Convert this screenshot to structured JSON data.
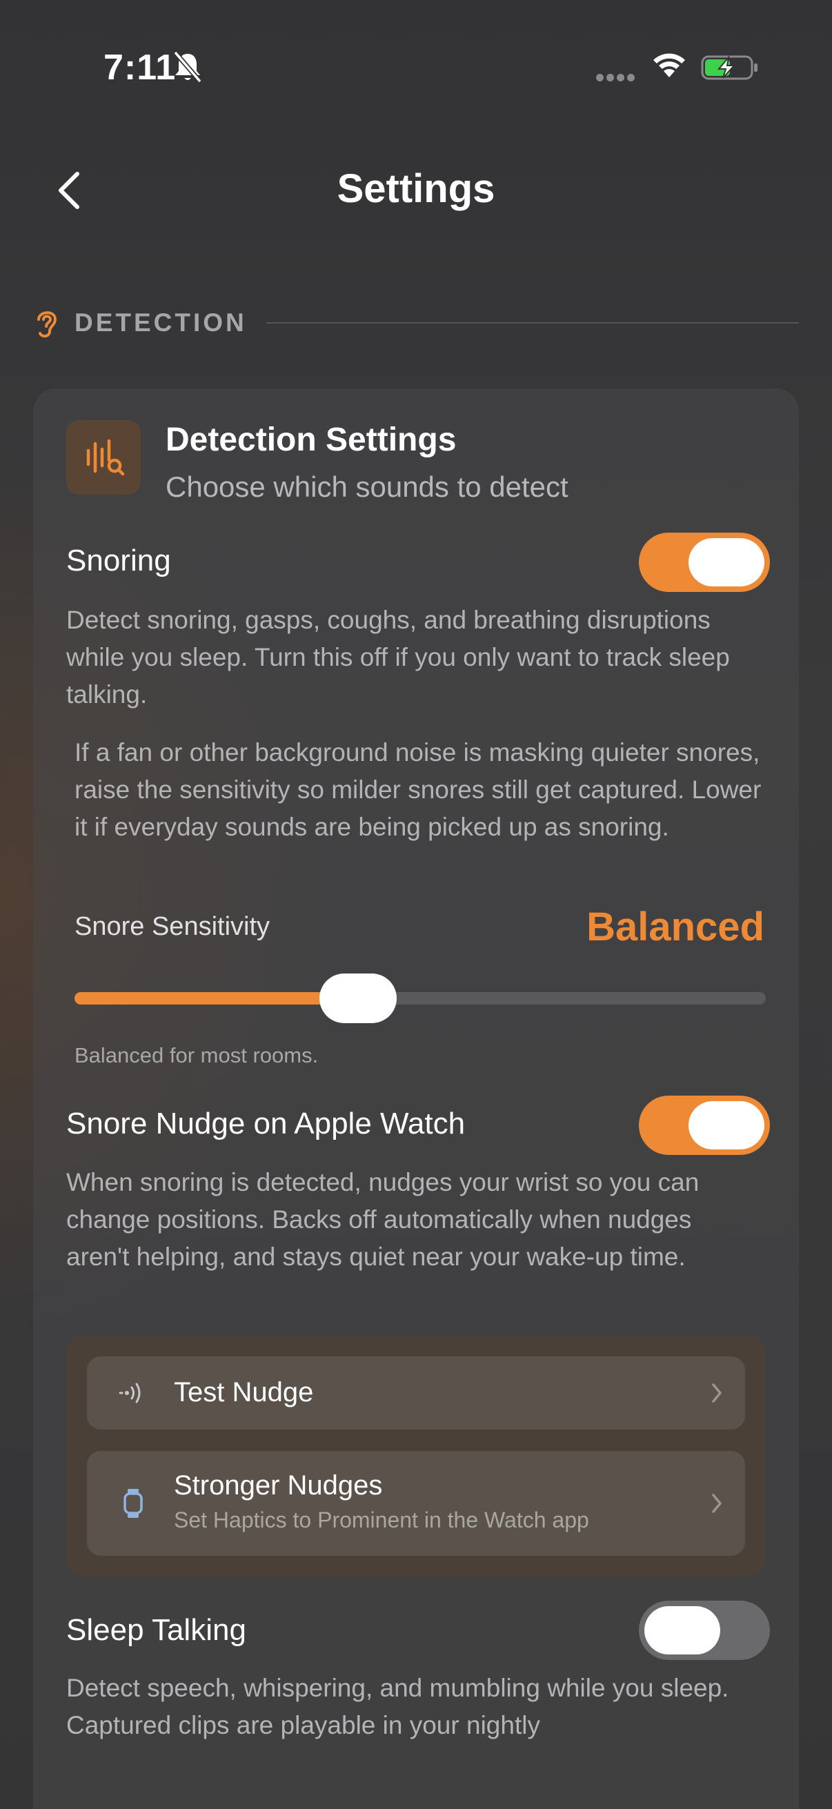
{
  "status_bar": {
    "time": "7:11",
    "icons": [
      "bell-slash-icon",
      "cellular-dots-icon",
      "wifi-icon",
      "battery-charging-icon"
    ]
  },
  "nav": {
    "title": "Settings",
    "back_icon": "chevron-left-icon"
  },
  "section": {
    "label": "DETECTION",
    "icon": "ear-icon"
  },
  "card": {
    "title": "Detection Settings",
    "subtitle": "Choose which sounds to detect",
    "icon": "waveform-search-icon"
  },
  "snoring": {
    "label": "Snoring",
    "enabled": true,
    "description": "Detect snoring, gasps, coughs, and breathing disruptions while you sleep. Turn this off if you only want to track sleep talking.",
    "sensitivity_help": "If a fan or other background noise is masking quieter snores, raise the sensitivity so milder snores still get captured. Lower it if everyday sounds are being picked up as snoring.",
    "sensitivity_label": "Snore Sensitivity",
    "sensitivity_value": "Balanced",
    "sensitivity_level": 0.41,
    "sensitivity_hint": "Balanced for most rooms."
  },
  "snore_nudge": {
    "label": "Snore Nudge on Apple Watch",
    "enabled": true,
    "description": "When snoring is detected, nudges your wrist so you can change positions. Backs off automatically when nudges aren't helping, and stays quiet near your wake-up time.",
    "rows": [
      {
        "title": "Test Nudge",
        "subtitle": "",
        "icon": "haptic-wave-icon"
      },
      {
        "title": "Stronger Nudges",
        "subtitle": "Set Haptics to Prominent in the Watch app",
        "icon": "watch-icon"
      }
    ]
  },
  "sleep_talking": {
    "label": "Sleep Talking",
    "enabled": false,
    "description": "Detect speech, whispering, and mumbling while you sleep. Captured clips are playable in your nightly"
  },
  "colors": {
    "accent": "#ee8a36",
    "background": "#363637",
    "card": "#434345"
  }
}
